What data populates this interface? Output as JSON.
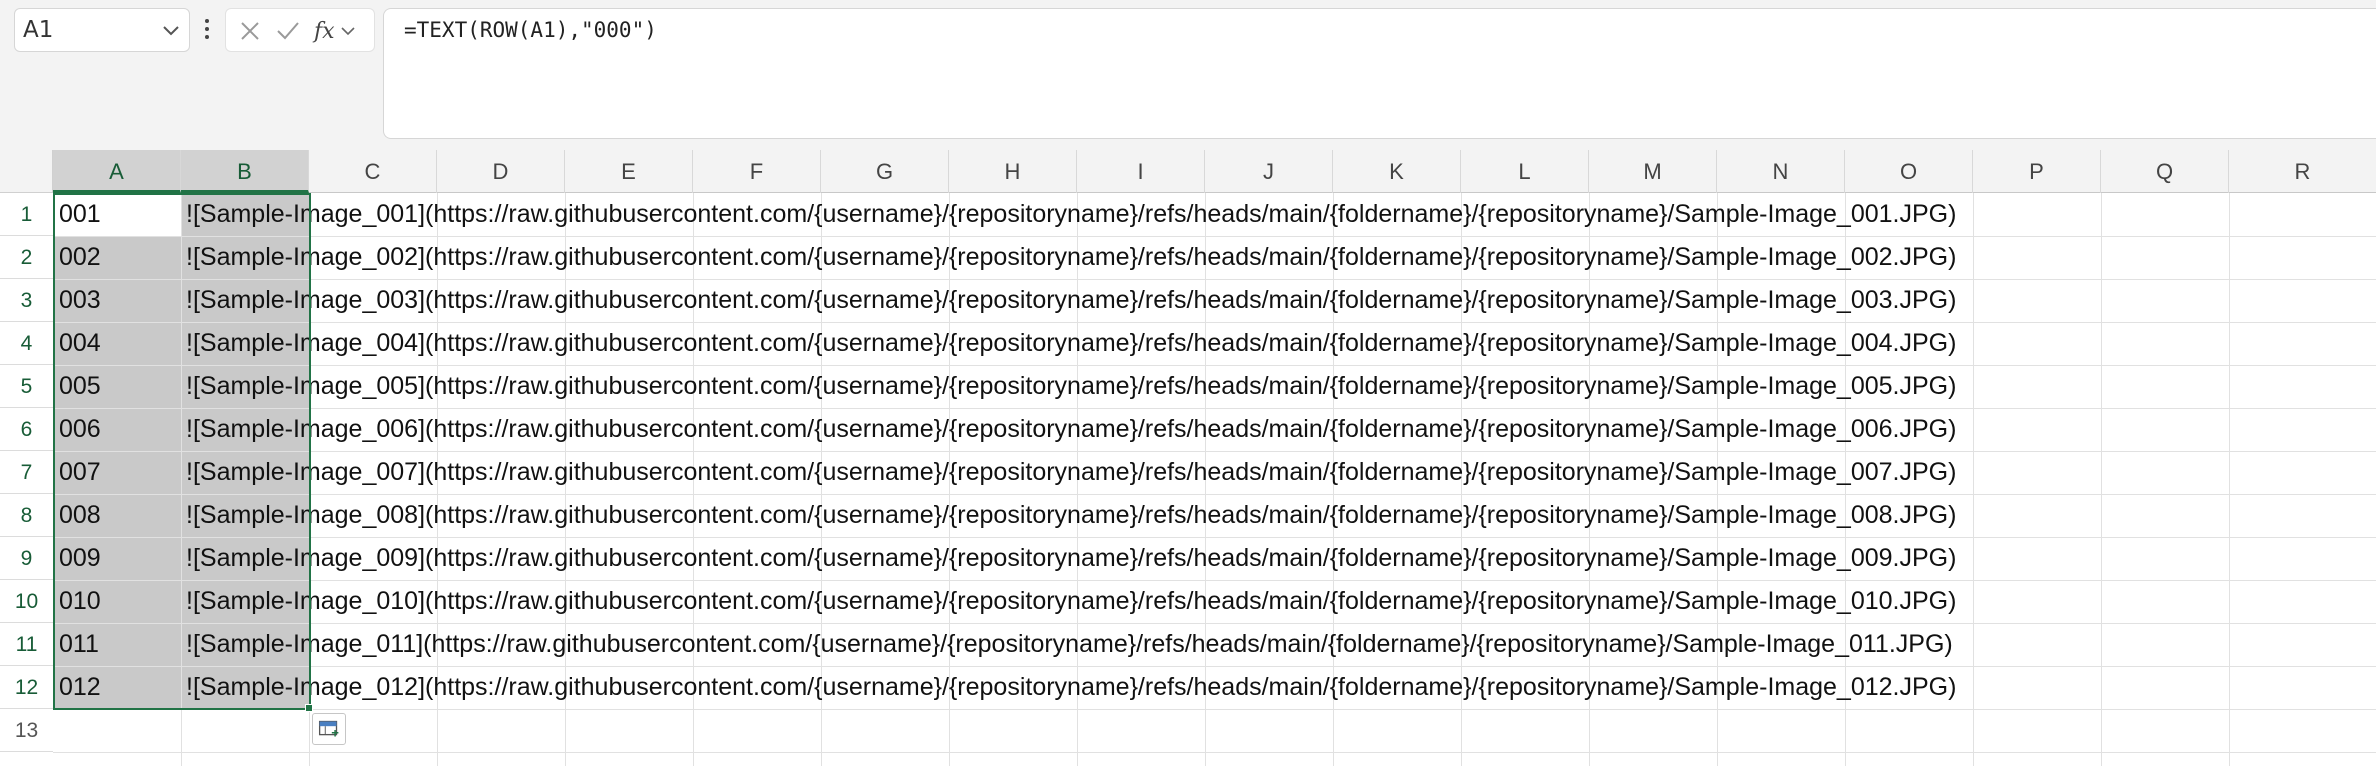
{
  "name_box": {
    "value": "A1"
  },
  "formula_bar": {
    "formula": "=TEXT(ROW(A1),\"000\")"
  },
  "icons": [
    "chevron-down-icon",
    "more-vertical-icon",
    "cancel-icon",
    "enter-icon",
    "insert-function-icon",
    "quick-analysis-icon"
  ],
  "columns": [
    "A",
    "B",
    "C",
    "D",
    "E",
    "F",
    "G",
    "H",
    "I",
    "J",
    "K",
    "L",
    "M",
    "N",
    "O",
    "P",
    "Q",
    "R"
  ],
  "selected_columns": [
    "A",
    "B"
  ],
  "rows": [
    {
      "num": "1",
      "a": "001",
      "b": "![Sample-Image_001](https://raw.githubusercontent.com/{username}/{repositoryname}/refs/heads/main/{foldername}/{repositoryname}/Sample-Image_001.JPG)"
    },
    {
      "num": "2",
      "a": "002",
      "b": "![Sample-Image_002](https://raw.githubusercontent.com/{username}/{repositoryname}/refs/heads/main/{foldername}/{repositoryname}/Sample-Image_002.JPG)"
    },
    {
      "num": "3",
      "a": "003",
      "b": "![Sample-Image_003](https://raw.githubusercontent.com/{username}/{repositoryname}/refs/heads/main/{foldername}/{repositoryname}/Sample-Image_003.JPG)"
    },
    {
      "num": "4",
      "a": "004",
      "b": "![Sample-Image_004](https://raw.githubusercontent.com/{username}/{repositoryname}/refs/heads/main/{foldername}/{repositoryname}/Sample-Image_004.JPG)"
    },
    {
      "num": "5",
      "a": "005",
      "b": "![Sample-Image_005](https://raw.githubusercontent.com/{username}/{repositoryname}/refs/heads/main/{foldername}/{repositoryname}/Sample-Image_005.JPG)"
    },
    {
      "num": "6",
      "a": "006",
      "b": "![Sample-Image_006](https://raw.githubusercontent.com/{username}/{repositoryname}/refs/heads/main/{foldername}/{repositoryname}/Sample-Image_006.JPG)"
    },
    {
      "num": "7",
      "a": "007",
      "b": "![Sample-Image_007](https://raw.githubusercontent.com/{username}/{repositoryname}/refs/heads/main/{foldername}/{repositoryname}/Sample-Image_007.JPG)"
    },
    {
      "num": "8",
      "a": "008",
      "b": "![Sample-Image_008](https://raw.githubusercontent.com/{username}/{repositoryname}/refs/heads/main/{foldername}/{repositoryname}/Sample-Image_008.JPG)"
    },
    {
      "num": "9",
      "a": "009",
      "b": "![Sample-Image_009](https://raw.githubusercontent.com/{username}/{repositoryname}/refs/heads/main/{foldername}/{repositoryname}/Sample-Image_009.JPG)"
    },
    {
      "num": "10",
      "a": "010",
      "b": "![Sample-Image_010](https://raw.githubusercontent.com/{username}/{repositoryname}/refs/heads/main/{foldername}/{repositoryname}/Sample-Image_010.JPG)"
    },
    {
      "num": "11",
      "a": "011",
      "b": "![Sample-Image_011](https://raw.githubusercontent.com/{username}/{repositoryname}/refs/heads/main/{foldername}/{repositoryname}/Sample-Image_011.JPG)"
    },
    {
      "num": "12",
      "a": "012",
      "b": "![Sample-Image_012](https://raw.githubusercontent.com/{username}/{repositoryname}/refs/heads/main/{foldername}/{repositoryname}/Sample-Image_012.JPG)"
    },
    {
      "num": "13",
      "a": "",
      "b": ""
    }
  ],
  "colors": {
    "accent": "#217346",
    "selection": "#c9c9c9",
    "header_bg": "#f3f3f3"
  }
}
